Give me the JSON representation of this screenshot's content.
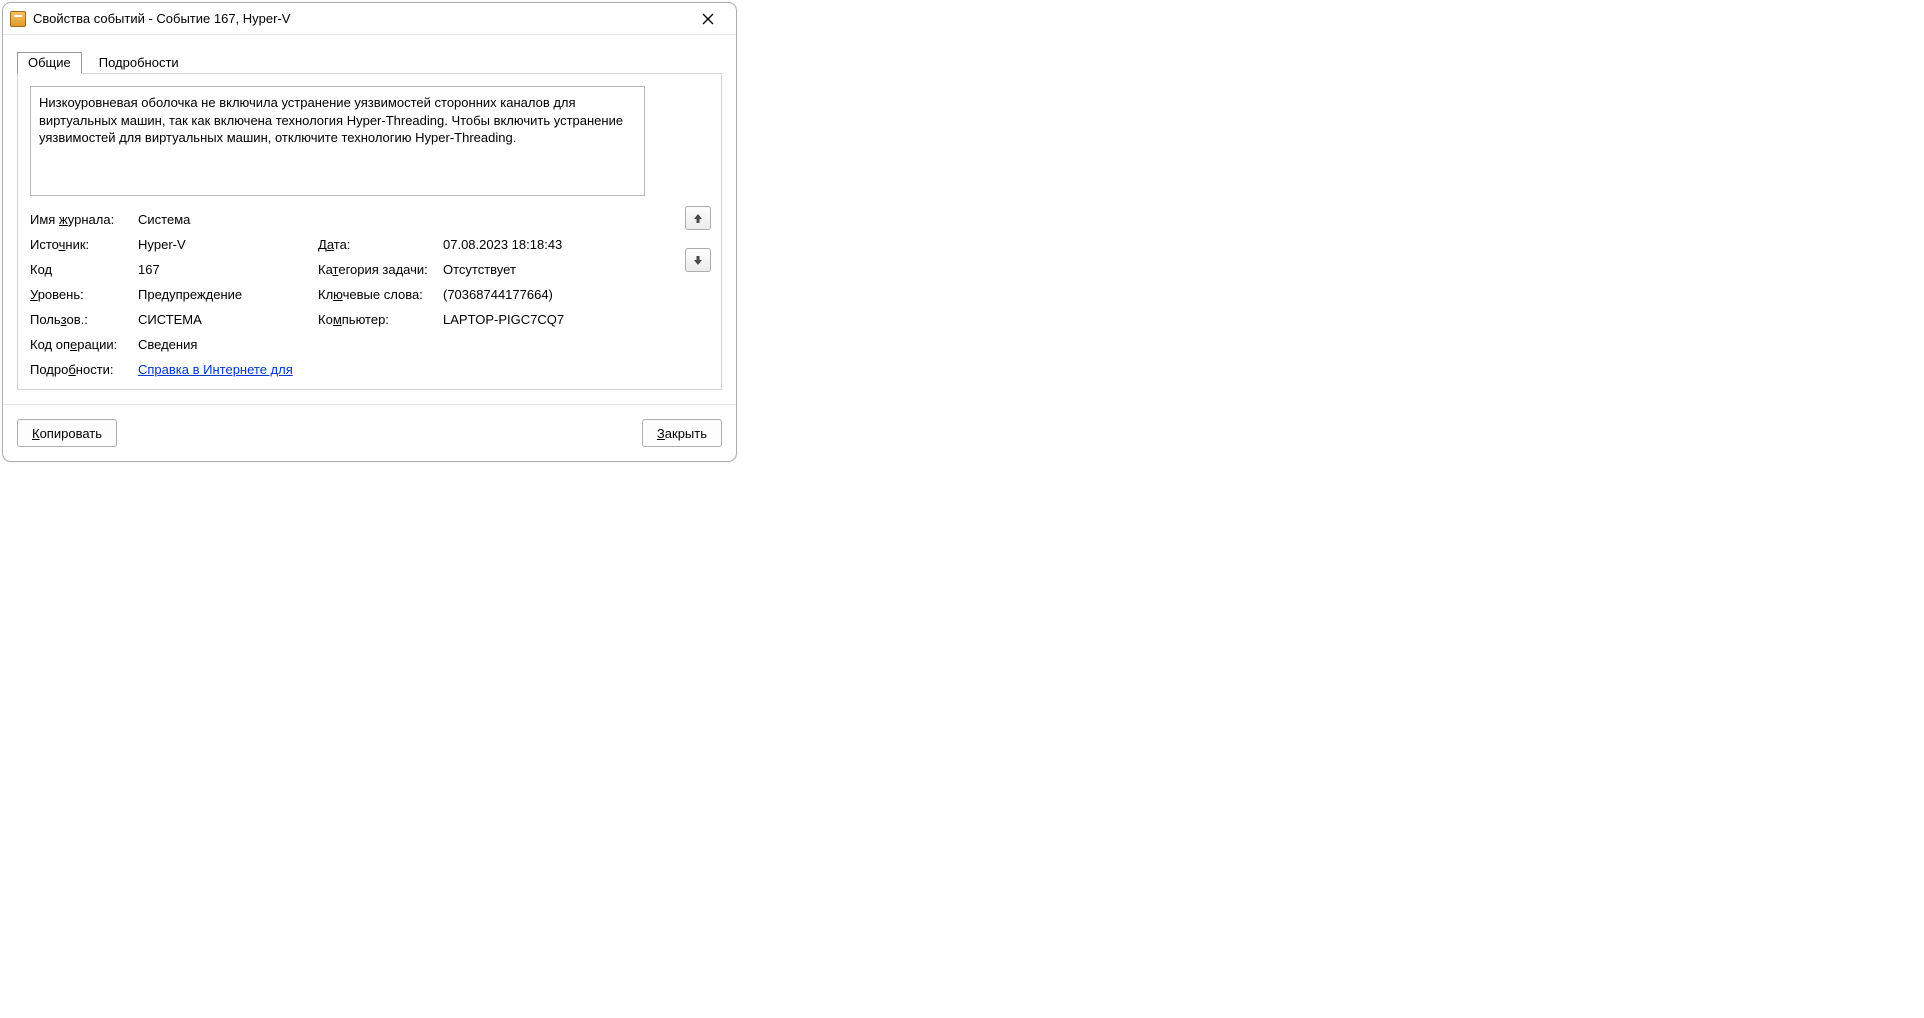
{
  "titlebar": {
    "title": "Свойства событий - Событие 167, Hyper-V"
  },
  "tabs": {
    "general": "Общие",
    "details": "Подробности"
  },
  "description": "Низкоуровневая оболочка не включила устранение уязвимостей сторонних каналов для виртуальных машин, так как включена технология Hyper-Threading. Чтобы включить устранение уязвимостей для виртуальных машин, отключите технологию Hyper-Threading.",
  "labels": {
    "log_name_pre": "Имя ",
    "log_name_ul": "ж",
    "log_name_post": "урнала:",
    "source_pre": "Исто",
    "source_ul": "ч",
    "source_post": "ник:",
    "event_id_pre": "Ко",
    "event_id_ul": "д",
    "event_id_post": "",
    "level_pre": "",
    "level_ul": "У",
    "level_post": "ровень:",
    "user_pre": "Поль",
    "user_ul": "з",
    "user_post": "ов.:",
    "opcode_pre": "Код оп",
    "opcode_ul": "е",
    "opcode_post": "рации:",
    "moreinfo_pre": "Подро",
    "moreinfo_ul": "б",
    "moreinfo_post": "ности:",
    "date_pre": "Д",
    "date_ul": "а",
    "date_post": "та:",
    "task_pre": "Ка",
    "task_ul": "т",
    "task_post": "егория задачи:",
    "keywords_pre": "Кл",
    "keywords_ul": "ю",
    "keywords_post": "чевые слова:",
    "computer_pre": "Ко",
    "computer_ul": "м",
    "computer_post": "пьютер:"
  },
  "values": {
    "log_name": "Система",
    "source": "Hyper-V",
    "event_id": "167",
    "level": "Предупреждение",
    "user": "СИСТЕМА",
    "opcode": "Сведения",
    "moreinfo_link": "Справка в Интернете для ",
    "date": "07.08.2023 18:18:43",
    "task": "Отсутствует",
    "keywords": "(70368744177664)",
    "computer": "LAPTOP-PIGC7CQ7"
  },
  "buttons": {
    "copy_pre": "",
    "copy_ul": "К",
    "copy_post": "опировать",
    "close_pre": "",
    "close_ul": "З",
    "close_post": "акрыть"
  }
}
